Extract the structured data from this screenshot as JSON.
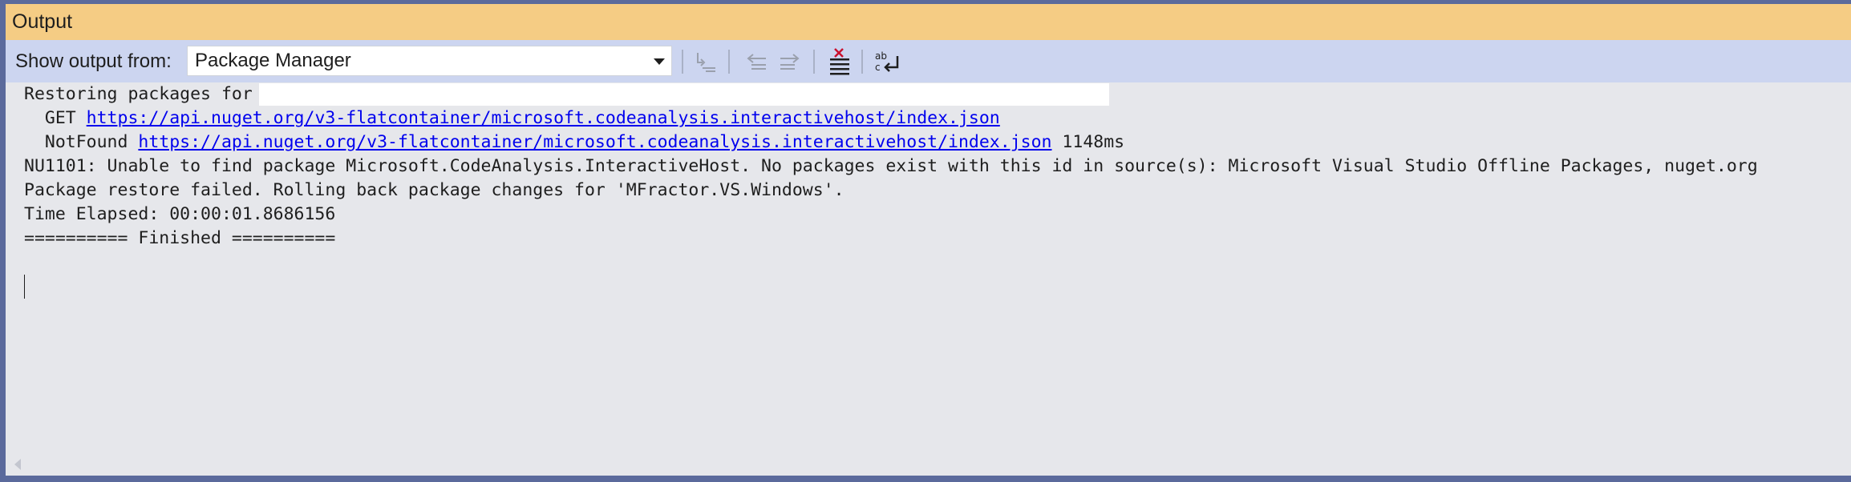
{
  "panel": {
    "title": "Output"
  },
  "toolbar": {
    "show_from_label": "Show output from:",
    "source_selected": "Package Manager",
    "buttons": [
      {
        "name": "find-message-in-code-icon"
      },
      {
        "name": "go-to-previous-message-icon"
      },
      {
        "name": "go-to-next-message-icon"
      },
      {
        "name": "clear-all-icon"
      },
      {
        "name": "toggle-word-wrap-icon"
      }
    ]
  },
  "output": {
    "line1": "Restoring packages for",
    "line2_prefix": "  GET ",
    "line2_url": "https://api.nuget.org/v3-flatcontainer/microsoft.codeanalysis.interactivehost/index.json",
    "line3_prefix": "  NotFound ",
    "line3_url": "https://api.nuget.org/v3-flatcontainer/microsoft.codeanalysis.interactivehost/index.json",
    "line3_suffix": " 1148ms",
    "line4": "NU1101: Unable to find package Microsoft.CodeAnalysis.InteractiveHost. No packages exist with this id in source(s): Microsoft Visual Studio Offline Packages, nuget.org",
    "line5": "Package restore failed. Rolling back package changes for 'MFractor.VS.Windows'.",
    "line6": "Time Elapsed: 00:00:01.8686156",
    "line7": "========== Finished =========="
  },
  "colors": {
    "titlebar": "#f5cc84",
    "toolbar": "#ccd5f0",
    "content_bg": "#e6e7eb",
    "link": "#0000ee",
    "frame": "#5b6a9c"
  }
}
